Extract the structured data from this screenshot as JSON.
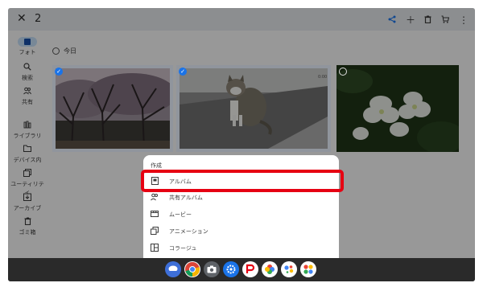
{
  "topbar": {
    "close_glyph": "✕",
    "selected_count": "2",
    "actions": [
      "share-icon",
      "add-icon",
      "delete-icon",
      "shop-icon",
      "more-icon"
    ]
  },
  "sidebar": {
    "items": [
      {
        "label": "フォト",
        "icon": "photo-icon",
        "active": true
      },
      {
        "label": "検索",
        "icon": "search-icon"
      },
      {
        "label": "共有",
        "icon": "people-icon"
      },
      {
        "label": "ライブラリ",
        "icon": "library-icon"
      },
      {
        "label": "デバイス内",
        "icon": "folder-icon"
      },
      {
        "label": "ユーティリティ",
        "icon": "utilities-icon"
      },
      {
        "label": "アーカイブ",
        "icon": "archive-icon"
      },
      {
        "label": "ゴミ箱",
        "icon": "trash-icon"
      }
    ]
  },
  "main": {
    "date_label": "今日",
    "photos": [
      {
        "name": "cherry-blossom-trees",
        "selected": true
      },
      {
        "name": "cat-on-road",
        "selected": true
      },
      {
        "name": "white-azalea-flowers",
        "selected": false
      }
    ]
  },
  "sheet": {
    "title": "作成",
    "items": [
      {
        "label": "アルバム",
        "icon": "album-icon"
      },
      {
        "label": "共有アルバム",
        "icon": "shared-album-icon"
      },
      {
        "label": "ムービー",
        "icon": "movie-icon"
      },
      {
        "label": "アニメーション",
        "icon": "animation-icon"
      },
      {
        "label": "コラージュ",
        "icon": "collage-icon"
      }
    ]
  },
  "dock": {
    "apps": [
      "messages-icon",
      "chrome-icon",
      "camera-icon",
      "settings-icon",
      "paypay-icon",
      "photos-icon",
      "assistant-icon",
      "apps-icon"
    ]
  }
}
